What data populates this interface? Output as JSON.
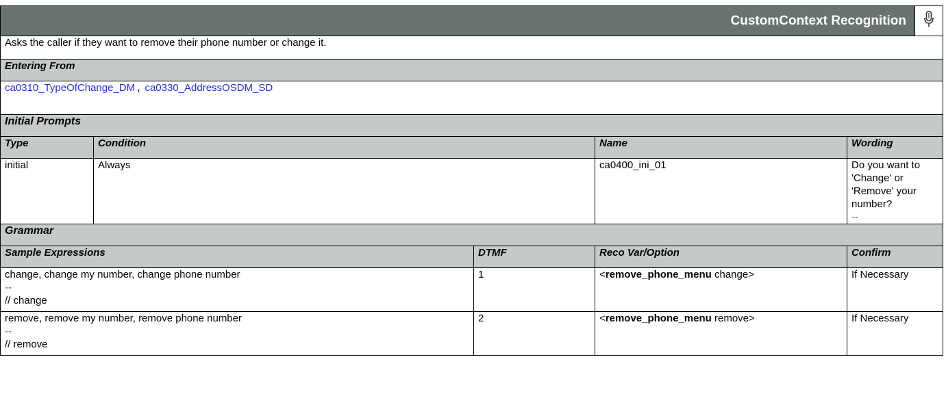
{
  "header": {
    "title": "CustomContext Recognition",
    "icon": "microphone-icon"
  },
  "description": "Asks the caller if they want to remove their phone number or change it.",
  "entering_from": {
    "label": "Entering From",
    "links": [
      "ca0310_TypeOfChange_DM",
      "ca0330_AddressOSDM_SD"
    ],
    "separator": ","
  },
  "initial_prompts": {
    "label": "Initial Prompts",
    "columns": [
      "Type",
      "Condition",
      "Name",
      "Wording"
    ],
    "rows": [
      {
        "type": "initial",
        "condition": "Always",
        "name": "ca0400_ini_01",
        "wording": "Do you want to 'Change' or 'Remove' your number?",
        "dash": "--"
      }
    ]
  },
  "grammar": {
    "label": "Grammar",
    "columns": [
      "Sample Expressions",
      "DTMF",
      "Reco Var/Option",
      "Confirm"
    ],
    "rows": [
      {
        "expressions": "change, change my number, change phone number",
        "dash": "--",
        "comment": "// change",
        "dtmf": "1",
        "reco_open": "<",
        "reco_var": "remove_phone_menu",
        "reco_option": " change>",
        "confirm": "If Necessary"
      },
      {
        "expressions": "remove, remove my number, remove phone number",
        "dash": "--",
        "comment": "// remove",
        "dtmf": "2",
        "reco_open": "<",
        "reco_var": "remove_phone_menu",
        "reco_option": " remove>",
        "confirm": "If Necessary"
      }
    ]
  }
}
